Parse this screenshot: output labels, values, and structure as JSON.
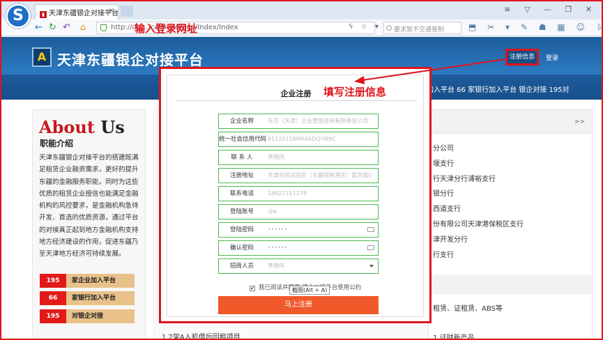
{
  "browser": {
    "tab_title": "天津东疆银企对接平台",
    "tab_close": "×",
    "url_visible": "http://d……cc/FrontPage/Index/Index",
    "search_placeholder": "要求暂不交通管制",
    "window_controls": "≡ ▽ — ❐ ✕"
  },
  "annotations": {
    "url_note": "输入登录网址",
    "fill_note": "填写注册信息"
  },
  "header": {
    "logo_glyph": "A",
    "site_title": "天津东疆银企对接平台",
    "register_link": "注册信息",
    "login_link": "登录",
    "stats_text": "加入平台  66 家银行加入平台  银企对接 195对"
  },
  "about": {
    "title_a": "About",
    "title_b": "Us",
    "subtitle": "职能介绍",
    "body": "天津东疆银企对接平台的搭建既满足租赁企业融资需求，更好的提升东疆的金融服务职能，同时为这些优质的租赁企业授信也能满足金融机构的风控要求，是金融机构急待开发、首选的优质资源，通过平台的对接真正起到地方金融机构支持地方经济建设的作用，促进东疆乃至天津地方经济可持续发展。",
    "stats": [
      {
        "num": "195",
        "label": "家企业加入平台"
      },
      {
        "num": "66",
        "label": "家银行加入平台"
      },
      {
        "num": "195",
        "label": "对银企对接"
      }
    ]
  },
  "bank_panel": {
    "more": ">>",
    "items": [
      "分公司",
      "堰支行",
      "行天津分行浦裕支行",
      "银分行",
      "西道支行",
      "份有限公司天津港保税区支行",
      "津开发分行",
      "行支行"
    ],
    "extra": "租赁、证租赁、ABS等",
    "bottom_right": "1  证财新产品",
    "bottom_mid": "1  2架A入机借后回租项目"
  },
  "modal": {
    "title": "企业注册",
    "fields": [
      {
        "label": "企业名称",
        "value": "东方（天津）企业管理咨询有限责任公司",
        "type": "text"
      },
      {
        "label": "统一社会信用代码",
        "value": "91120118MA06DQYN9C",
        "type": "text"
      },
      {
        "label": "联 系 人",
        "value": "李晓伟",
        "type": "text"
      },
      {
        "label": "注册地址",
        "value": "天津自贸试验区（东疆保税港区）重庆道以南，呼伦贝",
        "type": "text"
      },
      {
        "label": "联系电话",
        "value": "18622151278",
        "type": "text"
      },
      {
        "label": "登陆账号",
        "value": "lijw",
        "type": "text"
      },
      {
        "label": "登陆密码",
        "value": "••••••",
        "type": "password"
      },
      {
        "label": "确认密码",
        "value": "••••••",
        "type": "password"
      },
      {
        "label": "招商人员",
        "value": "李晓伟",
        "type": "select"
      }
    ],
    "agree_check": "✔",
    "agree_text": "我已阅读并同意  银企对接平台使用公约",
    "tooltip": "截图(Alt + A)",
    "submit": "马上注册"
  },
  "colors": {
    "annotation_red": "#e0141c",
    "header_blue": "#2b79c0",
    "field_border_green": "#4cb84c",
    "submit_orange": "#f0592a",
    "stat_red": "#e31a1a",
    "stat_tan": "#e8c28a"
  }
}
